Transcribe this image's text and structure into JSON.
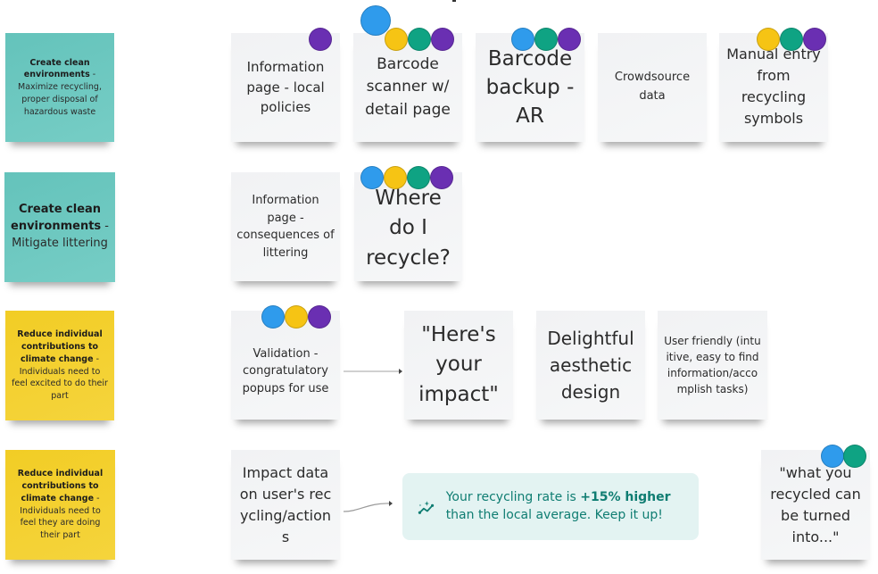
{
  "board": {
    "colors": {
      "teal_note": "#6cc7bf",
      "yellow_note": "#f3d02f",
      "white_note": "#f3f4f6",
      "dot_blue": "#2f9bec",
      "dot_yellow": "#f6c414",
      "dot_green": "#0fa383",
      "dot_purple": "#6a2fb2",
      "callout_bg": "#e3f3f2",
      "callout_text": "#0f7d72"
    },
    "goals": [
      {
        "title": "Create clean environments",
        "sep": " - ",
        "detail": "Maximize recycling, proper disposal of hazardous waste",
        "color": "teal"
      },
      {
        "title": "Create clean environments",
        "sep": " - ",
        "detail": "Mitigate littering",
        "color": "teal"
      },
      {
        "title": "Reduce individual contributions to climate change",
        "sep": " - ",
        "detail": "Individuals need to feel excited to do their part",
        "color": "yellow"
      },
      {
        "title": "Reduce individual contributions to climate change",
        "sep": " - ",
        "detail": "Individuals need to feel they are doing their part",
        "color": "yellow"
      }
    ],
    "ideas": {
      "row1": [
        {
          "text": "Information page - local policies",
          "votes": [
            "purple"
          ]
        },
        {
          "text": "Barcode scanner w/ detail page",
          "votes": [
            "blue",
            "yellow",
            "green",
            "purple"
          ]
        },
        {
          "text": "Barcode backup - AR",
          "votes": [
            "blue",
            "green",
            "purple"
          ]
        },
        {
          "text": "Crowdsource data",
          "votes": []
        },
        {
          "text": "Manual entry from recycling symbols",
          "votes": [
            "yellow",
            "green",
            "purple"
          ]
        }
      ],
      "row2": [
        {
          "text": "Information page - consequences of littering",
          "votes": []
        },
        {
          "text": "Where do I recycle?",
          "votes": [
            "blue",
            "yellow",
            "green",
            "purple"
          ]
        }
      ],
      "row3": [
        {
          "text": "Validation - congratulatory popups for use",
          "votes": [
            "blue",
            "yellow",
            "purple"
          ]
        },
        {
          "text": "\"Here's your impact\"",
          "votes": []
        },
        {
          "text": "Delightful aesthetic design",
          "votes": []
        },
        {
          "text": "User friendly (intuitive, easy to find information/accomplish tasks)",
          "votes": []
        }
      ],
      "row4": [
        {
          "text": "Impact data on user's recycling/actions",
          "votes": []
        },
        {
          "text": "\"what you recycled can be turned into...\"",
          "votes": [
            "blue",
            "green"
          ]
        }
      ]
    },
    "callout": {
      "icon": "sparkle-trend-icon",
      "text_before": "Your recycling rate is ",
      "text_bold": "+15% higher",
      "text_after": " than the local average. Keep it up!"
    }
  }
}
